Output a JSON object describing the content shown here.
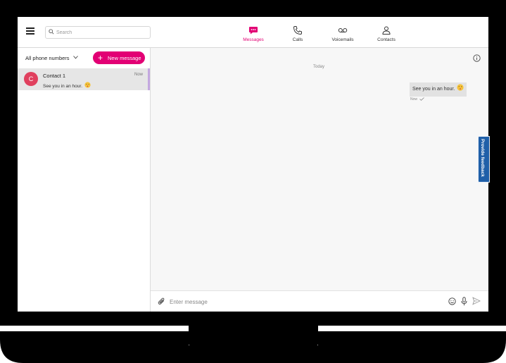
{
  "header": {
    "search_placeholder": "Search",
    "tabs": [
      {
        "label": "Messages",
        "icon": "message-icon",
        "active": true
      },
      {
        "label": "Calls",
        "icon": "phone-icon",
        "active": false
      },
      {
        "label": "Voicemails",
        "icon": "voicemail-icon",
        "active": false
      },
      {
        "label": "Contacts",
        "icon": "contacts-icon",
        "active": false
      }
    ]
  },
  "sidebar": {
    "phone_filter": "All phone numbers",
    "new_message_label": "New message",
    "conversations": [
      {
        "avatar_letter": "C",
        "name": "Contact 1",
        "time": "Now",
        "preview": "See you in an hour."
      }
    ]
  },
  "chat": {
    "day_label": "Today",
    "messages": [
      {
        "text": "See you in an hour.",
        "time": "Now",
        "status": "sent"
      }
    ]
  },
  "composer": {
    "placeholder": "Enter message"
  },
  "feedback_label": "Provide feedback",
  "colors": {
    "brand": "#e20074",
    "feedback": "#1f5fa8",
    "avatar": "#e0405e",
    "frame": "#000000"
  }
}
